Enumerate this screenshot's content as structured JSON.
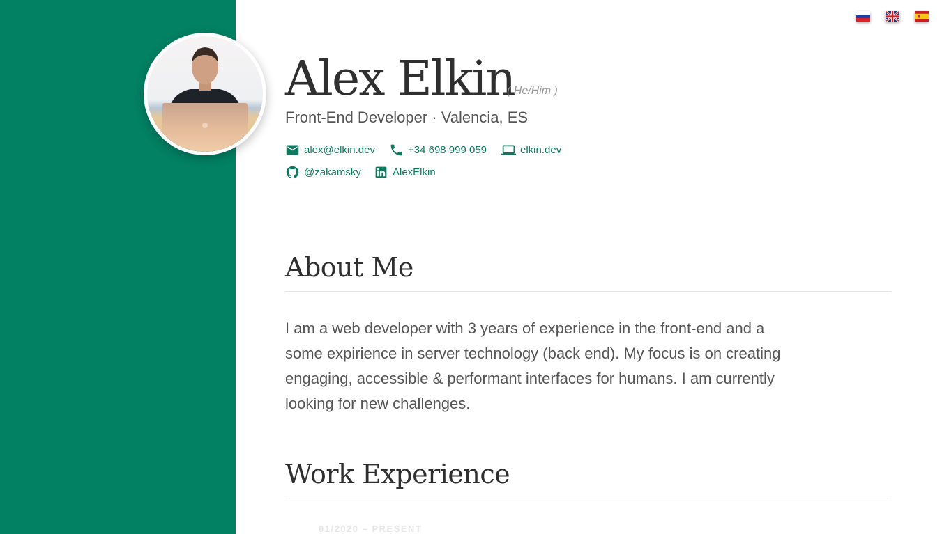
{
  "header": {
    "name": "Alex Elkin",
    "pronouns": "( He/Him )",
    "subtitle": "Front-End Developer · Valencia, ES"
  },
  "languages": [
    {
      "code": "ru",
      "icon": "flag-russia"
    },
    {
      "code": "en",
      "icon": "flag-uk"
    },
    {
      "code": "es",
      "icon": "flag-spain"
    }
  ],
  "contacts": {
    "email": "alex@elkin.dev",
    "phone": "+34 698 999 059",
    "website": "elkin.dev",
    "github": "@zakamsky",
    "linkedin": "AlexElkin"
  },
  "about": {
    "title": "About Me",
    "text": "I am a web developer with 3 years of experience in the front-end and a some expirience in server technology (back end). My focus is on creating engaging, accessible & performant interfaces for humans. I am currently looking for new challenges."
  },
  "work": {
    "title": "Work Experience",
    "first_job_date": "01/2020 – PRESENT"
  },
  "colors": {
    "accent": "#028163",
    "link": "#0d7a5f"
  }
}
